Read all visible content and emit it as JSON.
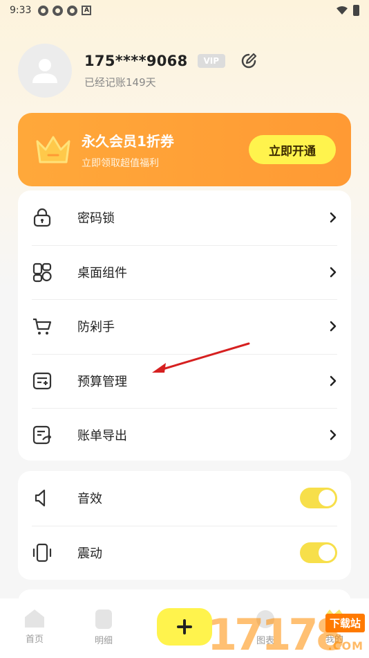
{
  "status_bar": {
    "time": "9:33"
  },
  "profile": {
    "username": "175****9068",
    "vip_badge": "VIP",
    "days_text": "已经记账149天"
  },
  "vip_banner": {
    "title": "永久会员1折券",
    "subtitle": "立即领取超值福利",
    "button": "立即开通"
  },
  "menu": {
    "items": [
      {
        "label": "密码锁",
        "icon": "lock-icon"
      },
      {
        "label": "桌面组件",
        "icon": "widgets-icon"
      },
      {
        "label": "防剁手",
        "icon": "cart-icon"
      },
      {
        "label": "预算管理",
        "icon": "budget-icon"
      },
      {
        "label": "账单导出",
        "icon": "export-icon"
      }
    ]
  },
  "settings": {
    "items": [
      {
        "label": "音效",
        "icon": "speaker-icon",
        "enabled": true
      },
      {
        "label": "震动",
        "icon": "vibrate-icon",
        "enabled": true
      }
    ]
  },
  "tabbar": {
    "tabs": [
      {
        "label": "首页",
        "icon": "home-icon"
      },
      {
        "label": "明细",
        "icon": "detail-icon"
      },
      {
        "label": "",
        "icon": "add-icon"
      },
      {
        "label": "图表",
        "icon": "chart-icon"
      },
      {
        "label": "我的",
        "icon": "mine-icon"
      }
    ]
  },
  "watermark": {
    "number": "17178",
    "tag": "下载站",
    "domain": ".COM"
  },
  "colors": {
    "accent_yellow": "#fff34d",
    "banner_orange": "#ff9a34",
    "toggle_on": "#f7df4a",
    "annotation_red": "#d62020"
  }
}
